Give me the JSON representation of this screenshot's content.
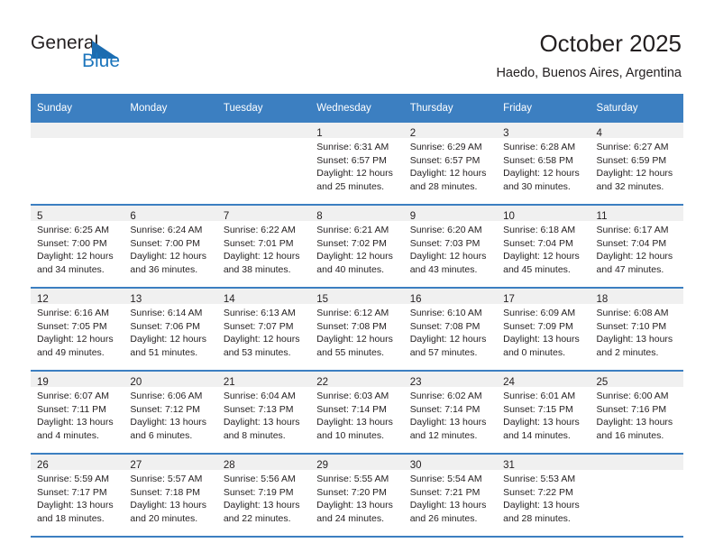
{
  "brand": {
    "name_part1": "General",
    "name_part2": "Blue",
    "triangle_color": "#1c6cb0",
    "blue_color": "#1c75bc"
  },
  "header": {
    "title": "October 2025",
    "subtitle": "Haedo, Buenos Aires, Argentina"
  },
  "theme": {
    "header_blue": "#3c7fc1",
    "daynum_band": "#f0f0f0",
    "text": "#231f20"
  },
  "weekday_headers": [
    "Sunday",
    "Monday",
    "Tuesday",
    "Wednesday",
    "Thursday",
    "Friday",
    "Saturday"
  ],
  "weeks": [
    [
      {
        "day": "",
        "lines": []
      },
      {
        "day": "",
        "lines": []
      },
      {
        "day": "",
        "lines": []
      },
      {
        "day": "1",
        "lines": [
          "Sunrise: 6:31 AM",
          "Sunset: 6:57 PM",
          "Daylight: 12 hours",
          "and 25 minutes."
        ]
      },
      {
        "day": "2",
        "lines": [
          "Sunrise: 6:29 AM",
          "Sunset: 6:57 PM",
          "Daylight: 12 hours",
          "and 28 minutes."
        ]
      },
      {
        "day": "3",
        "lines": [
          "Sunrise: 6:28 AM",
          "Sunset: 6:58 PM",
          "Daylight: 12 hours",
          "and 30 minutes."
        ]
      },
      {
        "day": "4",
        "lines": [
          "Sunrise: 6:27 AM",
          "Sunset: 6:59 PM",
          "Daylight: 12 hours",
          "and 32 minutes."
        ]
      }
    ],
    [
      {
        "day": "5",
        "lines": [
          "Sunrise: 6:25 AM",
          "Sunset: 7:00 PM",
          "Daylight: 12 hours",
          "and 34 minutes."
        ]
      },
      {
        "day": "6",
        "lines": [
          "Sunrise: 6:24 AM",
          "Sunset: 7:00 PM",
          "Daylight: 12 hours",
          "and 36 minutes."
        ]
      },
      {
        "day": "7",
        "lines": [
          "Sunrise: 6:22 AM",
          "Sunset: 7:01 PM",
          "Daylight: 12 hours",
          "and 38 minutes."
        ]
      },
      {
        "day": "8",
        "lines": [
          "Sunrise: 6:21 AM",
          "Sunset: 7:02 PM",
          "Daylight: 12 hours",
          "and 40 minutes."
        ]
      },
      {
        "day": "9",
        "lines": [
          "Sunrise: 6:20 AM",
          "Sunset: 7:03 PM",
          "Daylight: 12 hours",
          "and 43 minutes."
        ]
      },
      {
        "day": "10",
        "lines": [
          "Sunrise: 6:18 AM",
          "Sunset: 7:04 PM",
          "Daylight: 12 hours",
          "and 45 minutes."
        ]
      },
      {
        "day": "11",
        "lines": [
          "Sunrise: 6:17 AM",
          "Sunset: 7:04 PM",
          "Daylight: 12 hours",
          "and 47 minutes."
        ]
      }
    ],
    [
      {
        "day": "12",
        "lines": [
          "Sunrise: 6:16 AM",
          "Sunset: 7:05 PM",
          "Daylight: 12 hours",
          "and 49 minutes."
        ]
      },
      {
        "day": "13",
        "lines": [
          "Sunrise: 6:14 AM",
          "Sunset: 7:06 PM",
          "Daylight: 12 hours",
          "and 51 minutes."
        ]
      },
      {
        "day": "14",
        "lines": [
          "Sunrise: 6:13 AM",
          "Sunset: 7:07 PM",
          "Daylight: 12 hours",
          "and 53 minutes."
        ]
      },
      {
        "day": "15",
        "lines": [
          "Sunrise: 6:12 AM",
          "Sunset: 7:08 PM",
          "Daylight: 12 hours",
          "and 55 minutes."
        ]
      },
      {
        "day": "16",
        "lines": [
          "Sunrise: 6:10 AM",
          "Sunset: 7:08 PM",
          "Daylight: 12 hours",
          "and 57 minutes."
        ]
      },
      {
        "day": "17",
        "lines": [
          "Sunrise: 6:09 AM",
          "Sunset: 7:09 PM",
          "Daylight: 13 hours",
          "and 0 minutes."
        ]
      },
      {
        "day": "18",
        "lines": [
          "Sunrise: 6:08 AM",
          "Sunset: 7:10 PM",
          "Daylight: 13 hours",
          "and 2 minutes."
        ]
      }
    ],
    [
      {
        "day": "19",
        "lines": [
          "Sunrise: 6:07 AM",
          "Sunset: 7:11 PM",
          "Daylight: 13 hours",
          "and 4 minutes."
        ]
      },
      {
        "day": "20",
        "lines": [
          "Sunrise: 6:06 AM",
          "Sunset: 7:12 PM",
          "Daylight: 13 hours",
          "and 6 minutes."
        ]
      },
      {
        "day": "21",
        "lines": [
          "Sunrise: 6:04 AM",
          "Sunset: 7:13 PM",
          "Daylight: 13 hours",
          "and 8 minutes."
        ]
      },
      {
        "day": "22",
        "lines": [
          "Sunrise: 6:03 AM",
          "Sunset: 7:14 PM",
          "Daylight: 13 hours",
          "and 10 minutes."
        ]
      },
      {
        "day": "23",
        "lines": [
          "Sunrise: 6:02 AM",
          "Sunset: 7:14 PM",
          "Daylight: 13 hours",
          "and 12 minutes."
        ]
      },
      {
        "day": "24",
        "lines": [
          "Sunrise: 6:01 AM",
          "Sunset: 7:15 PM",
          "Daylight: 13 hours",
          "and 14 minutes."
        ]
      },
      {
        "day": "25",
        "lines": [
          "Sunrise: 6:00 AM",
          "Sunset: 7:16 PM",
          "Daylight: 13 hours",
          "and 16 minutes."
        ]
      }
    ],
    [
      {
        "day": "26",
        "lines": [
          "Sunrise: 5:59 AM",
          "Sunset: 7:17 PM",
          "Daylight: 13 hours",
          "and 18 minutes."
        ]
      },
      {
        "day": "27",
        "lines": [
          "Sunrise: 5:57 AM",
          "Sunset: 7:18 PM",
          "Daylight: 13 hours",
          "and 20 minutes."
        ]
      },
      {
        "day": "28",
        "lines": [
          "Sunrise: 5:56 AM",
          "Sunset: 7:19 PM",
          "Daylight: 13 hours",
          "and 22 minutes."
        ]
      },
      {
        "day": "29",
        "lines": [
          "Sunrise: 5:55 AM",
          "Sunset: 7:20 PM",
          "Daylight: 13 hours",
          "and 24 minutes."
        ]
      },
      {
        "day": "30",
        "lines": [
          "Sunrise: 5:54 AM",
          "Sunset: 7:21 PM",
          "Daylight: 13 hours",
          "and 26 minutes."
        ]
      },
      {
        "day": "31",
        "lines": [
          "Sunrise: 5:53 AM",
          "Sunset: 7:22 PM",
          "Daylight: 13 hours",
          "and 28 minutes."
        ]
      },
      {
        "day": "",
        "lines": []
      }
    ]
  ]
}
